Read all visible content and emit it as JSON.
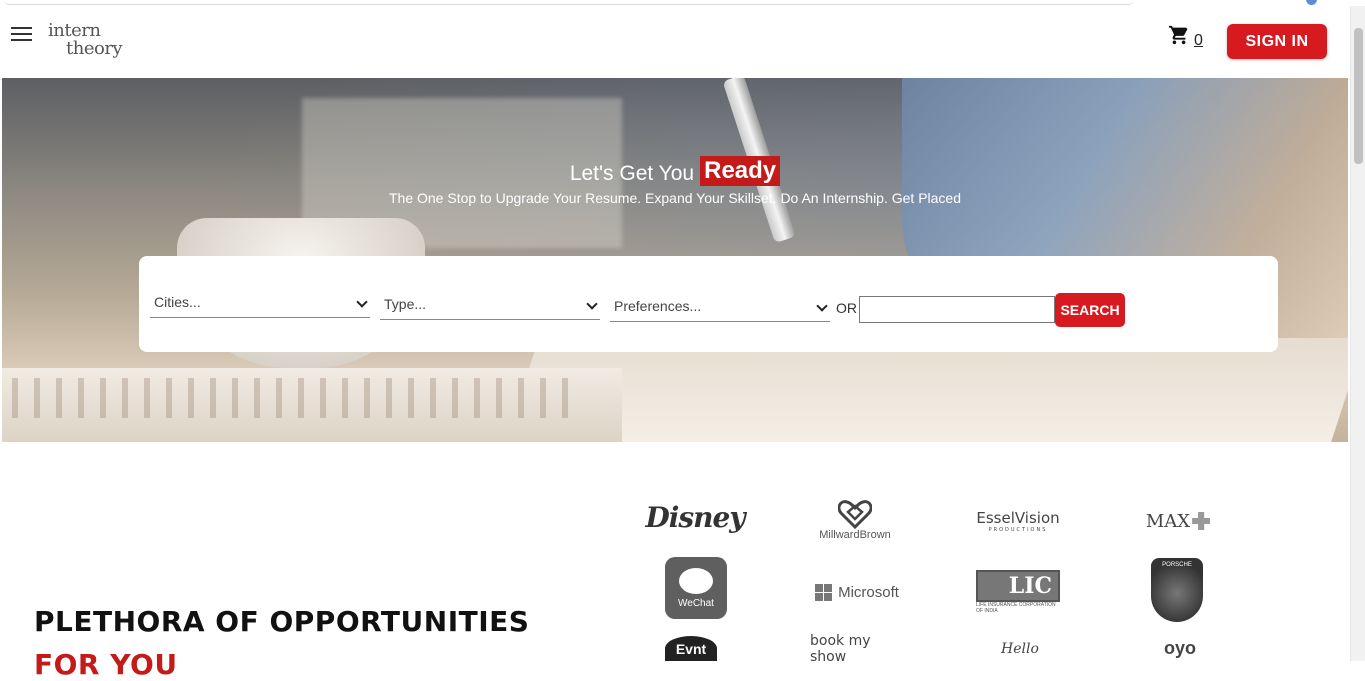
{
  "header": {
    "logo_line1": "intern",
    "logo_line2": "theory",
    "cart_count": "0",
    "signin_label": "SIGN IN"
  },
  "hero": {
    "headline_plain": "Let's Get You",
    "headline_highlight": "Ready",
    "subline": "The One Stop to Upgrade Your Resume. Expand Your Skillset. Do An Internship. Get Placed"
  },
  "search": {
    "cities_label": "Cities...",
    "type_label": "Type...",
    "preferences_label": "Preferences...",
    "or_label": "OR",
    "input_value": "",
    "button_label": "SEARCH"
  },
  "section": {
    "title": "PLETHORA OF OPPORTUNITIES",
    "subtitle": "FOR YOU"
  },
  "logos": {
    "disney": "Disney",
    "millward_brown": "MillwardBrown",
    "essel_vision": "EsselVision",
    "essel_sub": "PRODUCTIONS",
    "max": "MAX",
    "wechat": "WeChat",
    "microsoft": "Microsoft",
    "lic": "LIC",
    "lic_sub": "LIFE INSURANCE CORPORATION OF INDIA",
    "porsche": "PORSCHE",
    "eventr": "Evnt",
    "bookmyshow": "book my show",
    "hl": "Hello",
    "oyo": "oyo"
  },
  "colors": {
    "brand_red": "#d71920",
    "highlight_red": "#c41a1a"
  }
}
